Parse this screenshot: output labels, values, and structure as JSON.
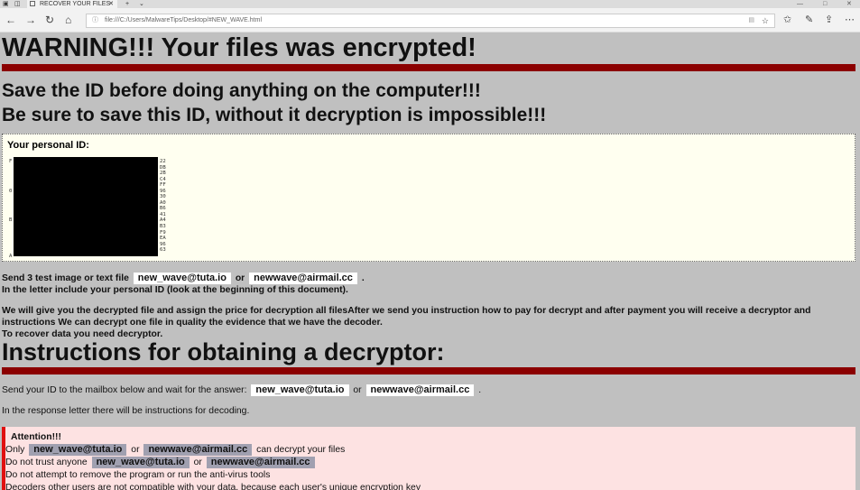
{
  "browser": {
    "tab_title": "RECOVER YOUR FILES",
    "url": "file:///C:/Users/MalwareTips/Desktop/#NEW_WAVE.html"
  },
  "page": {
    "title": "WARNING!!! Your files was encrypted!",
    "subtitle1": "Save the ID before doing anything on the computer!!!",
    "subtitle2": "Be sure to save this ID, without it decryption is impossible!!!",
    "id_label": "Your personal ID:",
    "id_hex_right": [
      "22",
      "DB",
      "2B",
      "C4",
      "FF",
      "96",
      "30",
      "A0",
      "B6",
      "41",
      "A4",
      "B3",
      "F9",
      "EA",
      "96",
      "63"
    ],
    "id_hex_left": [
      "F",
      "",
      "",
      "",
      "",
      "0",
      "",
      "",
      "",
      "",
      "B",
      "",
      "",
      "",
      "",
      "",
      "A"
    ],
    "send_prefix": "Send 3 test image or text file",
    "email1": "new_wave@tuta.io",
    "or": "or",
    "email2": "newwave@airmail.cc",
    "period": ".",
    "letter_note": "In the letter include your personal ID (look at the beginning of this document).",
    "give_text": "We will give you the decrypted file and assign the price for decryption all filesAfter we send you instruction how to pay for decrypt and after payment you will receive a decryptor and instructions We can decrypt one file in quality the evidence that we have the decoder.",
    "recover_text": "To recover data you need decryptor.",
    "instructions_title": "Instructions for obtaining a decryptor:",
    "send_id_text": "Send your ID to the mailbox below and wait for the answer:",
    "response_text": "In the response letter there will be instructions for decoding.",
    "attention_title": "Attention!!!",
    "only": "Only",
    "can_decrypt": "can decrypt your files",
    "do_not_trust": "Do not trust anyone",
    "do_not_attempt": "Do not attempt to remove the program or run the anti-virus tools",
    "decoders_note": "Decoders other users are not compatible with your data, because each user's unique encryption key"
  }
}
